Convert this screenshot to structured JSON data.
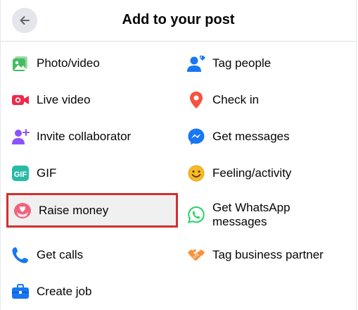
{
  "header": {
    "title": "Add to your post",
    "back_icon": "arrow-left-icon"
  },
  "left_items": [
    {
      "label": "Photo/video",
      "icon": "photo-video-icon",
      "color": "#45bd62"
    },
    {
      "label": "Live video",
      "icon": "live-video-icon",
      "color": "#f02849"
    },
    {
      "label": "Invite collaborator",
      "icon": "invite-collaborator-icon",
      "color": "#8c52ff"
    },
    {
      "label": "GIF",
      "icon": "gif-icon",
      "color": "#2abba7"
    },
    {
      "label": "Raise money",
      "icon": "raise-money-icon",
      "color": "#f3617f"
    },
    {
      "label": "Get calls",
      "icon": "phone-icon",
      "color": "#1877f2"
    },
    {
      "label": "Create job",
      "icon": "briefcase-icon",
      "color": "#1877f2"
    }
  ],
  "right_items": [
    {
      "label": "Tag people",
      "icon": "tag-people-icon",
      "color": "#1877f2"
    },
    {
      "label": "Check in",
      "icon": "location-pin-icon",
      "color": "#f5533d"
    },
    {
      "label": "Get messages",
      "icon": "messenger-icon",
      "color": "#1877f2"
    },
    {
      "label": "Feeling/activity",
      "icon": "smiley-icon",
      "color": "#f7b928"
    },
    {
      "label": "Get WhatsApp messages",
      "icon": "whatsapp-icon",
      "color": "#25d366"
    },
    {
      "label": "Tag business partner",
      "icon": "handshake-icon",
      "color": "#f7923b"
    }
  ],
  "selected_item": "Raise money"
}
